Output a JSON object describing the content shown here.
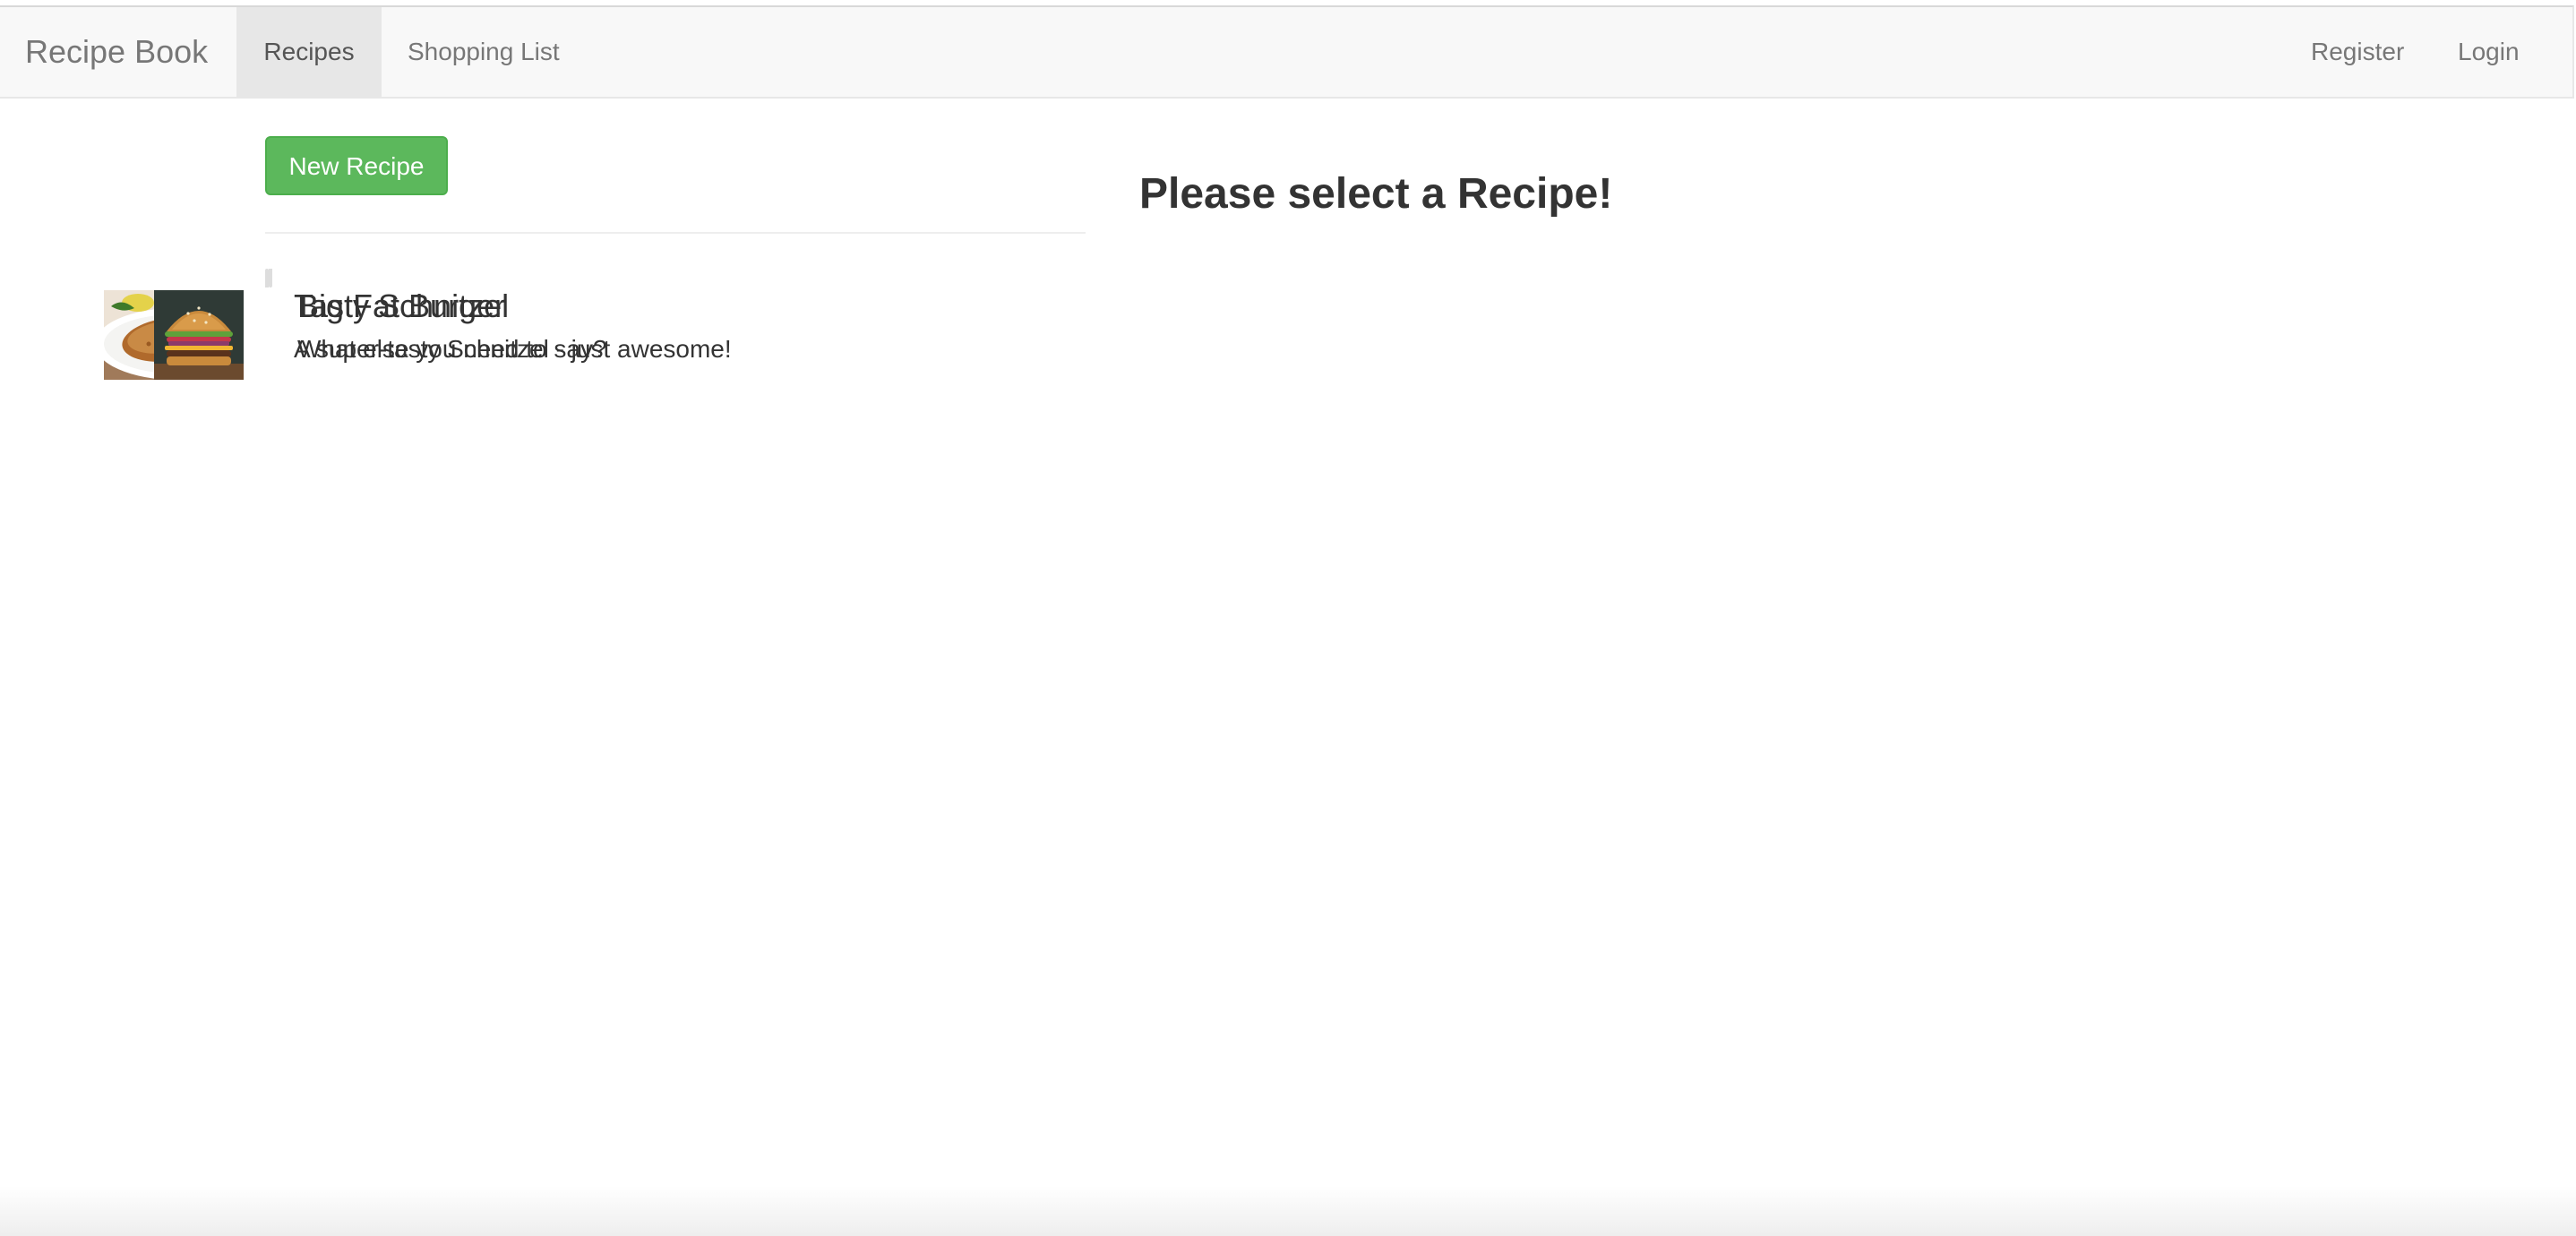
{
  "navbar": {
    "brand": "Recipe Book",
    "links": [
      {
        "label": "Recipes",
        "active": true
      },
      {
        "label": "Shopping List",
        "active": false
      }
    ],
    "right_links": [
      {
        "label": "Register"
      },
      {
        "label": "Login"
      }
    ]
  },
  "recipes": {
    "new_button_label": "New Recipe",
    "items": [
      {
        "name": "Tasty Schnitzel",
        "description": "A super-tasty Schnitzel - just awesome!",
        "image_icon": "schnitzel-image"
      },
      {
        "name": "Big Fat Burger",
        "description": "What else you need to say?",
        "image_icon": "burger-image"
      }
    ]
  },
  "detail": {
    "placeholder": "Please select a Recipe!"
  },
  "colors": {
    "navbar_bg": "#f8f8f8",
    "active_tab_bg": "#e7e7e7",
    "success_button": "#5cb85c",
    "text": "#333333",
    "muted_text": "#777777"
  }
}
